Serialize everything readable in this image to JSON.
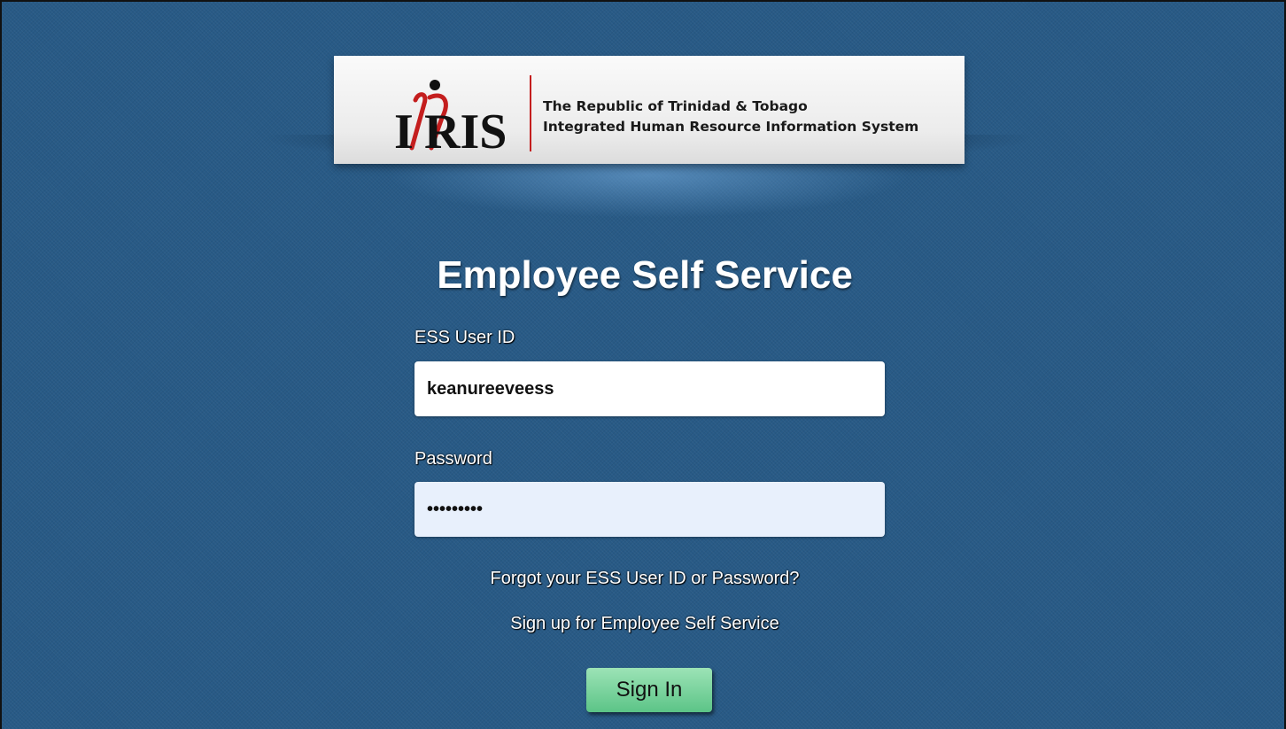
{
  "banner": {
    "logo_text": "IHRIS",
    "line1": "The Republic of Trinidad & Tobago",
    "line2": "Integrated Human Resource Information System"
  },
  "title": "Employee Self Service",
  "form": {
    "user_id_label": "ESS User ID",
    "user_id_value": "keanureeveess",
    "password_label": "Password",
    "password_value": "•••••••••"
  },
  "links": {
    "forgot": "Forgot your ESS User ID or Password?",
    "signup": "Sign up for Employee Self Service"
  },
  "signin_label": "Sign In",
  "colors": {
    "background": "#285a86",
    "logo_red": "#c41e1e",
    "button_green": "#6fcf97",
    "password_fill": "#e8f0fc"
  }
}
